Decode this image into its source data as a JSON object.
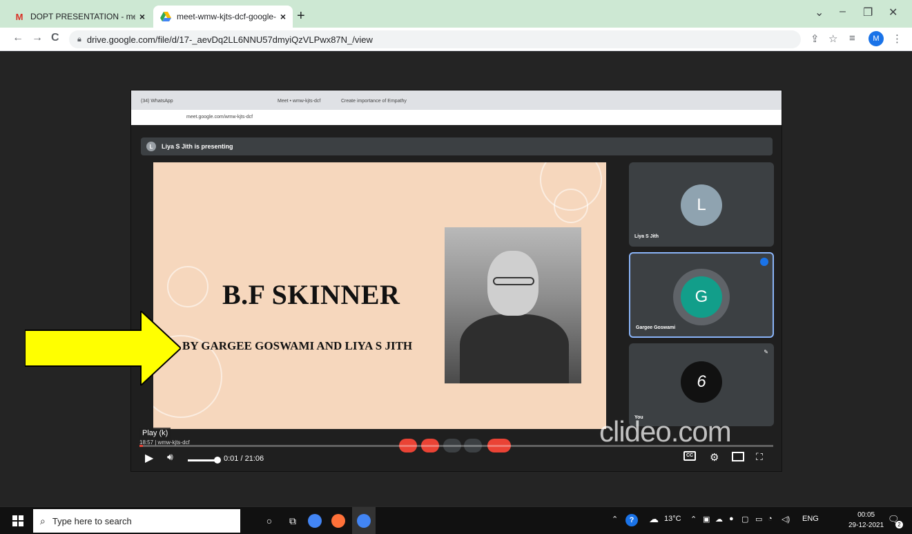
{
  "browser": {
    "tabs": [
      {
        "title": "DOPT PRESENTATION - meghadi",
        "close": "×"
      },
      {
        "title": "meet-wmw-kjts-dcf-google-chro",
        "close": "×"
      }
    ],
    "new_tab": "+",
    "url": "drive.google.com/file/d/17-_aevDq2LL6NNU57dmyiQzVLPwx87N_/view",
    "profile_initial": "M"
  },
  "video": {
    "inner_browser": {
      "tabs": [
        "(34) WhatsApp",
        "Meet • wmw-kjts-dcf",
        "Create importance of Empathy"
      ],
      "url": "meet.google.com/wmw-kjts-dcf"
    },
    "presenting_banner": "Liya S Jith is presenting",
    "presenter_initial": "L",
    "slide": {
      "title": "B.F SKINNER",
      "subtitle": "BY GARGEE GOSWAMI AND LIYA S JITH"
    },
    "participants": [
      {
        "initial": "L",
        "name": "Liya S Jith",
        "color": "#8fa3b0"
      },
      {
        "initial": "G",
        "name": "Gargee Goswami",
        "color": "#129e8a"
      },
      {
        "initial": "6",
        "name": "You",
        "color": "#111111"
      }
    ],
    "watermark": "clideo.com",
    "play_tooltip": "Play (k)",
    "meeting_code": "18:57 | wmw-kjts-dcf",
    "time_current": "0:01",
    "time_total": "21:06",
    "time_display": "0:01 / 21:06",
    "progress": 0.0008,
    "volume": 1.0
  },
  "taskbar": {
    "search_placeholder": "Type here to search",
    "weather": "13°C",
    "language": "ENG",
    "time": "00:05",
    "date": "29-12-2021",
    "notification_count": "2"
  }
}
